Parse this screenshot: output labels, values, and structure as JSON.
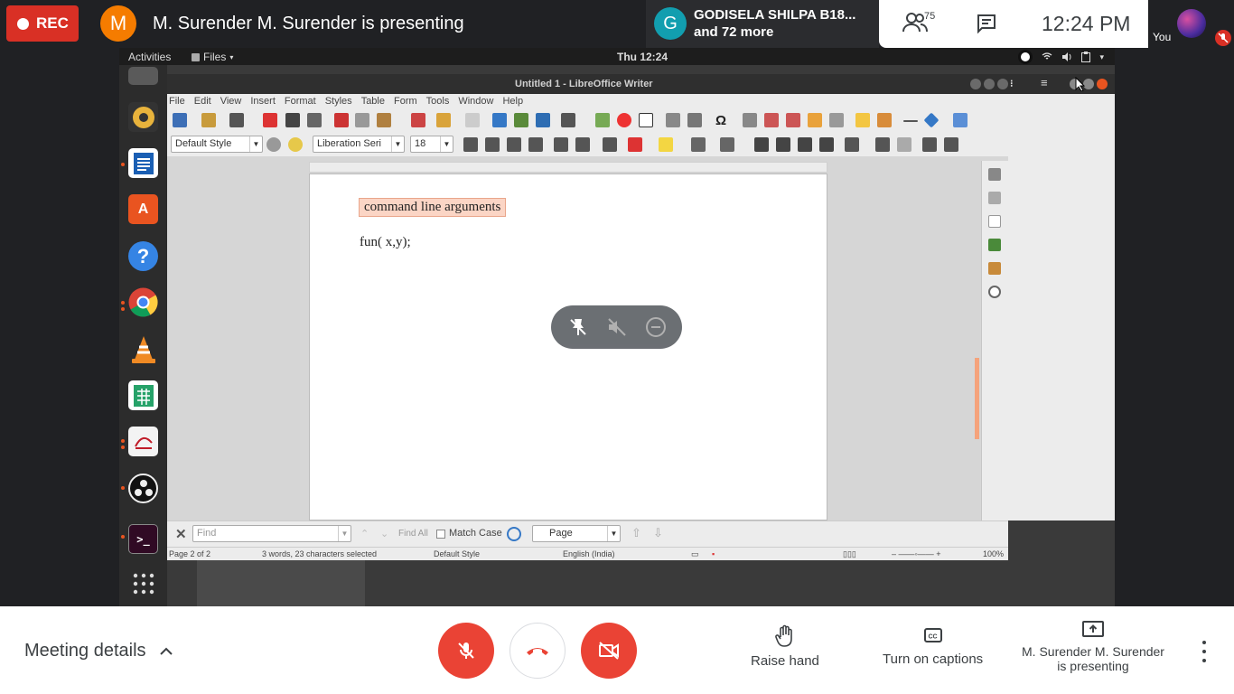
{
  "meet": {
    "recording_label": "REC",
    "presenter_initial": "M",
    "presenting_title": "M. Surender M. Surender is presenting",
    "participant": {
      "initial": "G",
      "name": "GODISELA SHILPA B18...",
      "more": "and 72 more"
    },
    "participant_count": "75",
    "clock": "12:24 PM",
    "you_label": "You",
    "bottom": {
      "meeting_details": "Meeting details",
      "raise_hand": "Raise hand",
      "captions": "Turn on captions",
      "presenting_line1": "M. Surender M. Surender",
      "presenting_line2": "is presenting"
    }
  },
  "desktop": {
    "activities": "Activities",
    "files_menu": "Files",
    "clock": "Thu 12:24",
    "window_title": "Untitled 1 - LibreOffice Writer",
    "menu": [
      "File",
      "Edit",
      "View",
      "Insert",
      "Format",
      "Styles",
      "Table",
      "Form",
      "Tools",
      "Window",
      "Help"
    ],
    "paragraph_style": "Default Style",
    "font_name": "Liberation Seri",
    "font_size": "18",
    "document": {
      "line1": "command line arguments",
      "line2": "fun( x,y);"
    },
    "find": {
      "placeholder": "Find",
      "find_all": "Find All",
      "match_case": "Match Case",
      "search_scope": "Page"
    },
    "status": {
      "page": "Page 2 of 2",
      "words": "3 words, 23 characters selected",
      "style": "Default Style",
      "language": "English (India)",
      "zoom": "100%"
    }
  },
  "colors": {
    "rec_red": "#d93025",
    "presenter_orange": "#f57c00",
    "participant_teal": "#129eaf",
    "control_red": "#ea4335",
    "selection_highlight": "#fbd5c5"
  }
}
